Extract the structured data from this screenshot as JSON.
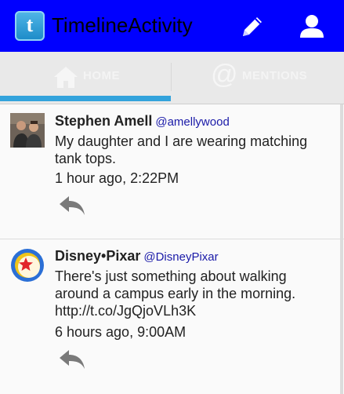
{
  "action_bar": {
    "title": "TimelineActivity",
    "icons": {
      "app": "twitter-bird-icon",
      "edit": "pencil-icon",
      "profile": "person-icon"
    },
    "color": "#0000ff"
  },
  "tabs": [
    {
      "label": "HOME",
      "icon": "home-icon",
      "selected": true
    },
    {
      "label": "MENTIONS",
      "icon": "at-sign-icon",
      "selected": false
    }
  ],
  "tab_indicator_color": "#33a3dc",
  "tweets": [
    {
      "name": "Stephen Amell",
      "handle": "@amellywood",
      "text": "My daughter and I are wearing matching tank tops.",
      "time": "1 hour ago, 2:22PM",
      "reply_icon": "reply-icon"
    },
    {
      "name": "Disney•Pixar",
      "handle": "@DisneyPixar",
      "text": "There's just something about walking around a campus early in the morning. http://t.co/JgQjoVLh3K",
      "time": "6 hours ago, 9:00AM",
      "reply_icon": "reply-icon"
    }
  ]
}
